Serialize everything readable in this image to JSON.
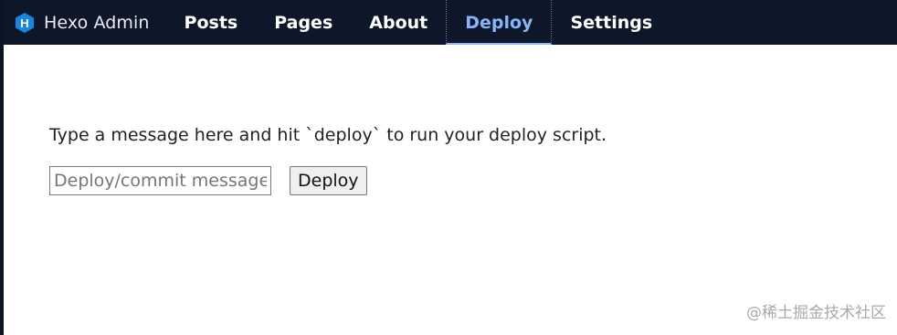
{
  "app": {
    "title": "Hexo Admin",
    "logo_icon": "hexo-hexagon-icon",
    "logo_letter": "H",
    "brand_color": "#1a85e0"
  },
  "nav": {
    "items": [
      {
        "label": "Posts"
      },
      {
        "label": "Pages"
      },
      {
        "label": "About"
      },
      {
        "label": "Deploy",
        "active": true
      },
      {
        "label": "Settings"
      }
    ],
    "active_color": "#8ab4f8",
    "background": "#0e1729"
  },
  "deploy": {
    "instructions": "Type a message here and hit `deploy` to run your deploy script.",
    "input_value": "",
    "input_placeholder": "Deploy/commit message",
    "button_label": "Deploy"
  },
  "watermark": "@稀土掘金技术社区"
}
